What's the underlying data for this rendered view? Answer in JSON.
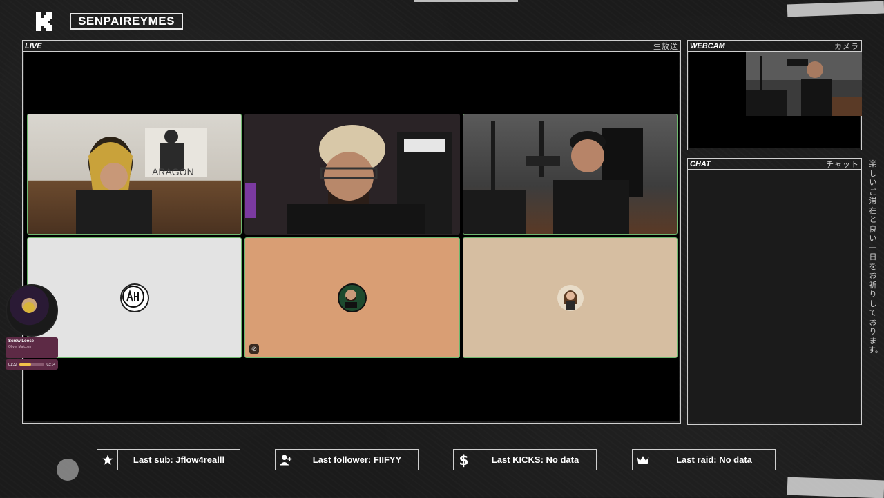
{
  "header": {
    "channel_name": "SENPAIREYMES"
  },
  "live_panel": {
    "title": "LIVE",
    "title_jp": "生放送"
  },
  "webcam_panel": {
    "title": "WEBCAM",
    "title_jp": "カメラ"
  },
  "chat_panel": {
    "title": "CHAT",
    "title_jp": "チャット"
  },
  "side_message": "楽しいご滞在と良い一日をお祈りしております。",
  "now_playing": {
    "song": "Screw Loose",
    "artist": "Oliver Malcolm",
    "elapsed": "01:32",
    "duration": "03:14",
    "progress": 0.47
  },
  "stats": [
    {
      "icon": "star-icon",
      "label": "Last sub: Jflow4realll"
    },
    {
      "icon": "user-plus-icon",
      "label": "Last follower: FIIFYY"
    },
    {
      "icon": "dollar-icon",
      "label": "Last KICKS: No data"
    },
    {
      "icon": "crown-icon",
      "label": "Last raid: No data"
    }
  ],
  "colors": {
    "tile_border": "#6fb86f",
    "tile_bg_1": "#e3e3e3",
    "tile_bg_2": "#d99e74",
    "tile_bg_3": "#d6bea1",
    "music_accent": "#5d2a45"
  }
}
